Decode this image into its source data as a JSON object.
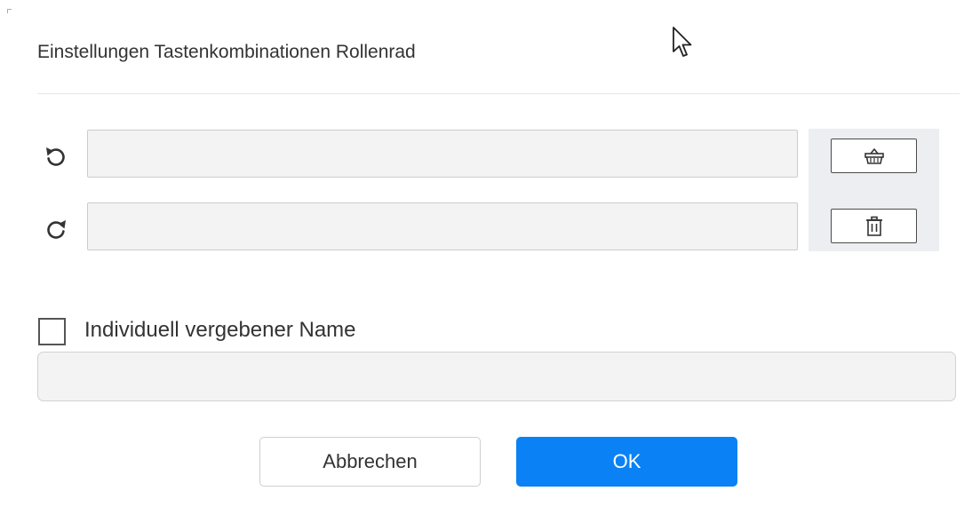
{
  "dialog": {
    "title": "Einstellungen Tastenkombinationen Rollenrad"
  },
  "shortcuts": {
    "rotate_left": {
      "icon": "rotate-ccw-icon",
      "value": ""
    },
    "rotate_right": {
      "icon": "rotate-cw-icon",
      "value": ""
    },
    "clear_icon": "broom-basket-icon",
    "delete_icon": "trash-icon"
  },
  "custom_name": {
    "checked": false,
    "label": "Individuell vergebener Name",
    "value": ""
  },
  "footer": {
    "cancel_label": "Abbrechen",
    "ok_label": "OK"
  },
  "colors": {
    "primary": "#0a82f5",
    "panel": "#eceef1",
    "field": "#f3f3f3"
  }
}
